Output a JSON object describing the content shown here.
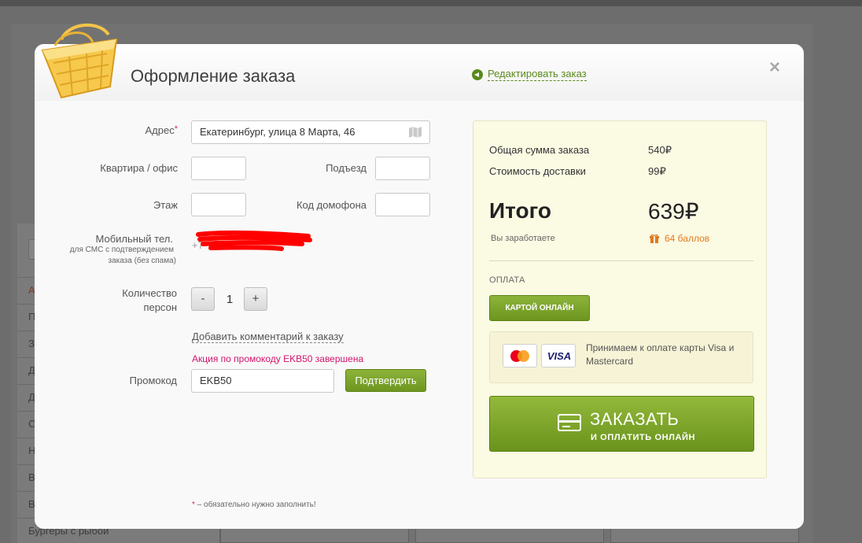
{
  "background": {
    "sidebar_items": [
      {
        "label": "А",
        "active": true
      },
      {
        "label": "П",
        "active": false
      },
      {
        "label": "З",
        "active": false
      },
      {
        "label": "Д",
        "active": false
      },
      {
        "label": "Д",
        "active": false
      },
      {
        "label": "С",
        "active": false
      },
      {
        "label": "Н",
        "active": false
      },
      {
        "label": "В",
        "active": false
      },
      {
        "label": "В",
        "active": false
      },
      {
        "label": "Бургеры с рыбой",
        "active": false
      }
    ]
  },
  "modal": {
    "title": "Оформление заказа",
    "edit_link": "Редактировать заказ",
    "close": "×"
  },
  "form": {
    "address_label": "Адрес",
    "required_mark": "*",
    "address_value": "Екатеринбург, улица 8 Марта, 46",
    "apartment_label": "Квартира / офис",
    "apartment_value": "",
    "entrance_label": "Подъезд",
    "entrance_value": "",
    "floor_label": "Этаж",
    "floor_value": "",
    "intercom_label": "Код домофона",
    "intercom_value": "",
    "phone_label": "Мобильный тел.",
    "phone_hint_1": "для СМС с подтверждением",
    "phone_hint_2": "заказа (без спама)",
    "phone_prefix": "+7",
    "persons_label_1": "Количество",
    "persons_label_2": "персон",
    "persons_minus": "-",
    "persons_value": "1",
    "persons_plus": "+",
    "comment_link": "Добавить комментарий к заказу",
    "promo_message": "Акция по промокоду EKB50 завершена",
    "promo_label": "Промокод",
    "promo_value": "EKB50",
    "confirm_button": "Подтвердить",
    "footnote_star": "*",
    "footnote_text": " – обязательно нужно заполнить!"
  },
  "summary": {
    "order_sum_label": "Общая сумма заказа",
    "order_sum_value": "540₽",
    "delivery_label": "Стоимость доставки",
    "delivery_value": "99₽",
    "total_label": "Итого",
    "total_value": "639₽",
    "earn_label": "Вы заработаете",
    "earn_value": "64 баллов",
    "payment_heading": "ОПЛАТА",
    "pay_card_button": "КАРТОЙ ОНЛАЙН",
    "cards_text": "Принимаем к оплате карты Visa и Mastercard",
    "visa_logo": "VISA",
    "order_button_main": "ЗАКАЗАТЬ",
    "order_button_sub": "И ОПЛАТИТЬ ОНЛАЙН"
  },
  "colors": {
    "accent_green": "#7aa32a",
    "promo_error": "#d1156b",
    "points_orange": "#e07a1d",
    "summary_bg": "#fbfae3"
  }
}
